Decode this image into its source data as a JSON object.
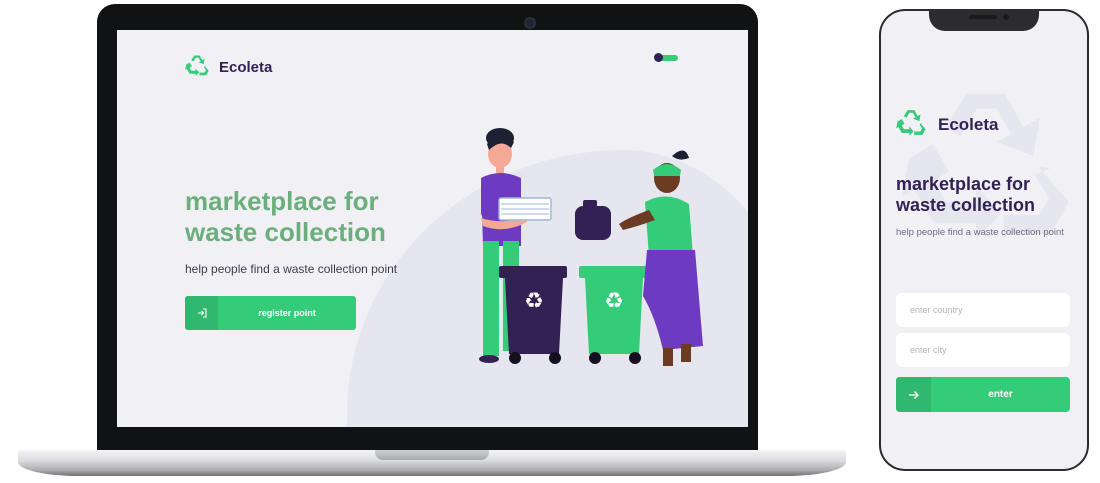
{
  "colors": {
    "accent_green": "#34cb79",
    "dark_purple": "#322153",
    "headline_green": "#6cae7c",
    "screen_bg": "#f0f0f5"
  },
  "desktop": {
    "brand": {
      "name": "Ecoleta",
      "icon": "recycle-icon"
    },
    "hero": {
      "headline": "marketplace for waste collection",
      "subtitle": "help people find a waste collection point",
      "cta_label": "register point",
      "cta_icon": "sign-in-icon"
    }
  },
  "mobile": {
    "brand": {
      "name": "Ecoleta",
      "icon": "recycle-icon"
    },
    "headline": "marketplace for waste collection",
    "subtitle": "help people find a waste collection point",
    "country_placeholder": "enter country",
    "city_placeholder": "enter city",
    "enter_label": "enter",
    "enter_icon": "arrow-right-icon"
  }
}
